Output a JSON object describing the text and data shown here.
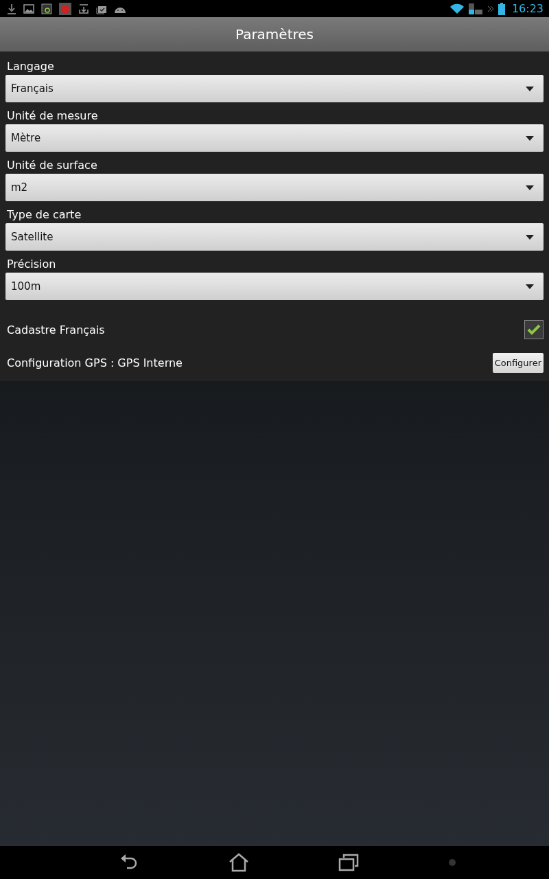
{
  "status_bar": {
    "time": "16:23"
  },
  "title": "Paramètres",
  "settings": [
    {
      "label": "Langage",
      "value": "Français"
    },
    {
      "label": "Unité de mesure",
      "value": "Mètre"
    },
    {
      "label": "Unité de surface",
      "value": "m2"
    },
    {
      "label": "Type de carte",
      "value": "Satellite"
    },
    {
      "label": "Précision",
      "value": "100m"
    }
  ],
  "cadastre": {
    "label": "Cadastre Français",
    "checked": true
  },
  "gps": {
    "label": "Configuration GPS : GPS Interne",
    "button": "Configurer"
  }
}
